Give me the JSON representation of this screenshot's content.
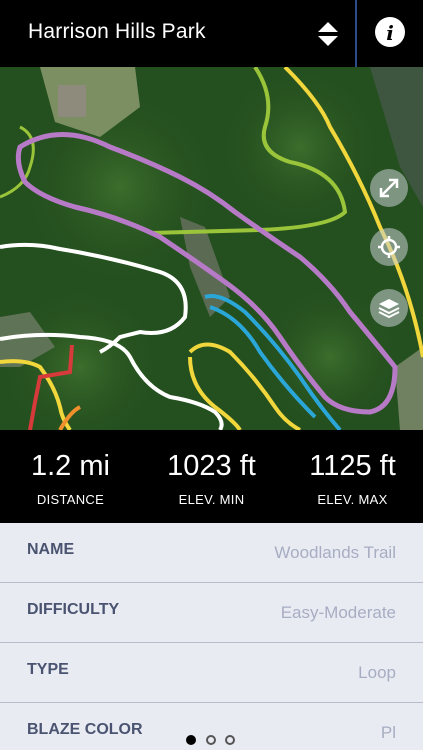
{
  "header": {
    "title": "Harrison Hills Park",
    "sort_icon": "sort-up-down-icon",
    "info_icon": "info-icon",
    "info_glyph": "i"
  },
  "map": {
    "controls": [
      {
        "name": "fullscreen-icon"
      },
      {
        "name": "locate-icon"
      },
      {
        "name": "layers-icon"
      }
    ],
    "trail_colors": {
      "selected": "#b77ac6",
      "yellow": "#f1d73c",
      "green": "#9ac43a",
      "white": "#ffffff",
      "blue": "#2aa7d8",
      "red": "#d73a3a",
      "orange": "#f0902c"
    }
  },
  "stats": [
    {
      "value": "1.2 mi",
      "label": "DISTANCE"
    },
    {
      "value": "1023 ft",
      "label": "ELEV. MIN"
    },
    {
      "value": "1125 ft",
      "label": "ELEV. MAX"
    }
  ],
  "details": [
    {
      "label": "NAME",
      "value": "Woodlands Trail"
    },
    {
      "label": "DIFFICULTY",
      "value": "Easy-Moderate"
    },
    {
      "label": "TYPE",
      "value": "Loop"
    },
    {
      "label": "BLAZE COLOR",
      "value": "Pl"
    }
  ],
  "pager": {
    "total": 3,
    "active_index": 0
  }
}
